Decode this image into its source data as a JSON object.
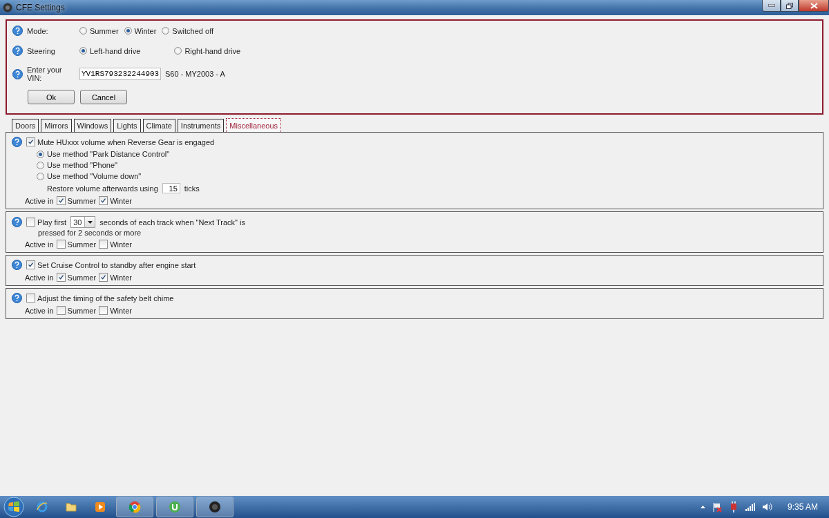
{
  "window": {
    "title": "CFE Settings"
  },
  "settings": {
    "mode": {
      "label": "Mode:",
      "options": [
        {
          "label": "Summer",
          "selected": false
        },
        {
          "label": "Winter",
          "selected": true
        },
        {
          "label": "Switched off",
          "selected": false
        }
      ]
    },
    "steering": {
      "label": "Steering",
      "options": [
        {
          "label": "Left-hand drive",
          "selected": true
        },
        {
          "label": "Right-hand drive",
          "selected": false
        }
      ]
    },
    "vin": {
      "label": "Enter your VIN:",
      "value": "YV1RS793232244903",
      "info": "S60 - MY2003 - A"
    },
    "buttons": [
      "Ok",
      "Cancel"
    ]
  },
  "tabs": [
    {
      "label": "Doors",
      "selected": false
    },
    {
      "label": "Mirrors",
      "selected": false
    },
    {
      "label": "Windows",
      "selected": false
    },
    {
      "label": "Lights",
      "selected": false
    },
    {
      "label": "Climate",
      "selected": false
    },
    {
      "label": "Instruments",
      "selected": false
    },
    {
      "label": "Miscellaneous",
      "selected": true
    }
  ],
  "panels": [
    {
      "kind": "methods",
      "label": "Mute HUxxx volume when Reverse Gear is engaged",
      "checked": true,
      "methods": [
        {
          "label": "Use method \"Park Distance Control\"",
          "selected": true
        },
        {
          "label": "Use method \"Phone\"",
          "selected": false
        },
        {
          "label": "Use method \"Volume down\"",
          "selected": false
        }
      ],
      "restore": {
        "before": "Restore volume afterwards using",
        "value": "15",
        "after": "ticks"
      },
      "active_label": "Active in",
      "active": [
        {
          "label": "Summer",
          "checked": true
        },
        {
          "label": "Winter",
          "checked": true
        }
      ]
    },
    {
      "kind": "play",
      "label": "Play first",
      "checked": false,
      "dropdown": "30",
      "after": "seconds of each track when \"Next Track\" is",
      "line2": "pressed for 2 seconds or more",
      "active_label": "Active in",
      "active": [
        {
          "label": "Summer",
          "checked": false
        },
        {
          "label": "Winter",
          "checked": false
        }
      ]
    },
    {
      "kind": "plain",
      "label": "Set Cruise Control to standby after engine start",
      "checked": true,
      "active_label": "Active in",
      "active": [
        {
          "label": "Summer",
          "checked": true
        },
        {
          "label": "Winter",
          "checked": true
        }
      ]
    },
    {
      "kind": "plain",
      "label": "Adjust the timing of the safety belt chime",
      "checked": false,
      "active_label": "Active in",
      "active": [
        {
          "label": "Summer",
          "checked": false
        },
        {
          "label": "Winter",
          "checked": false
        }
      ]
    }
  ],
  "taskbar": {
    "clock": "9:35 AM"
  }
}
